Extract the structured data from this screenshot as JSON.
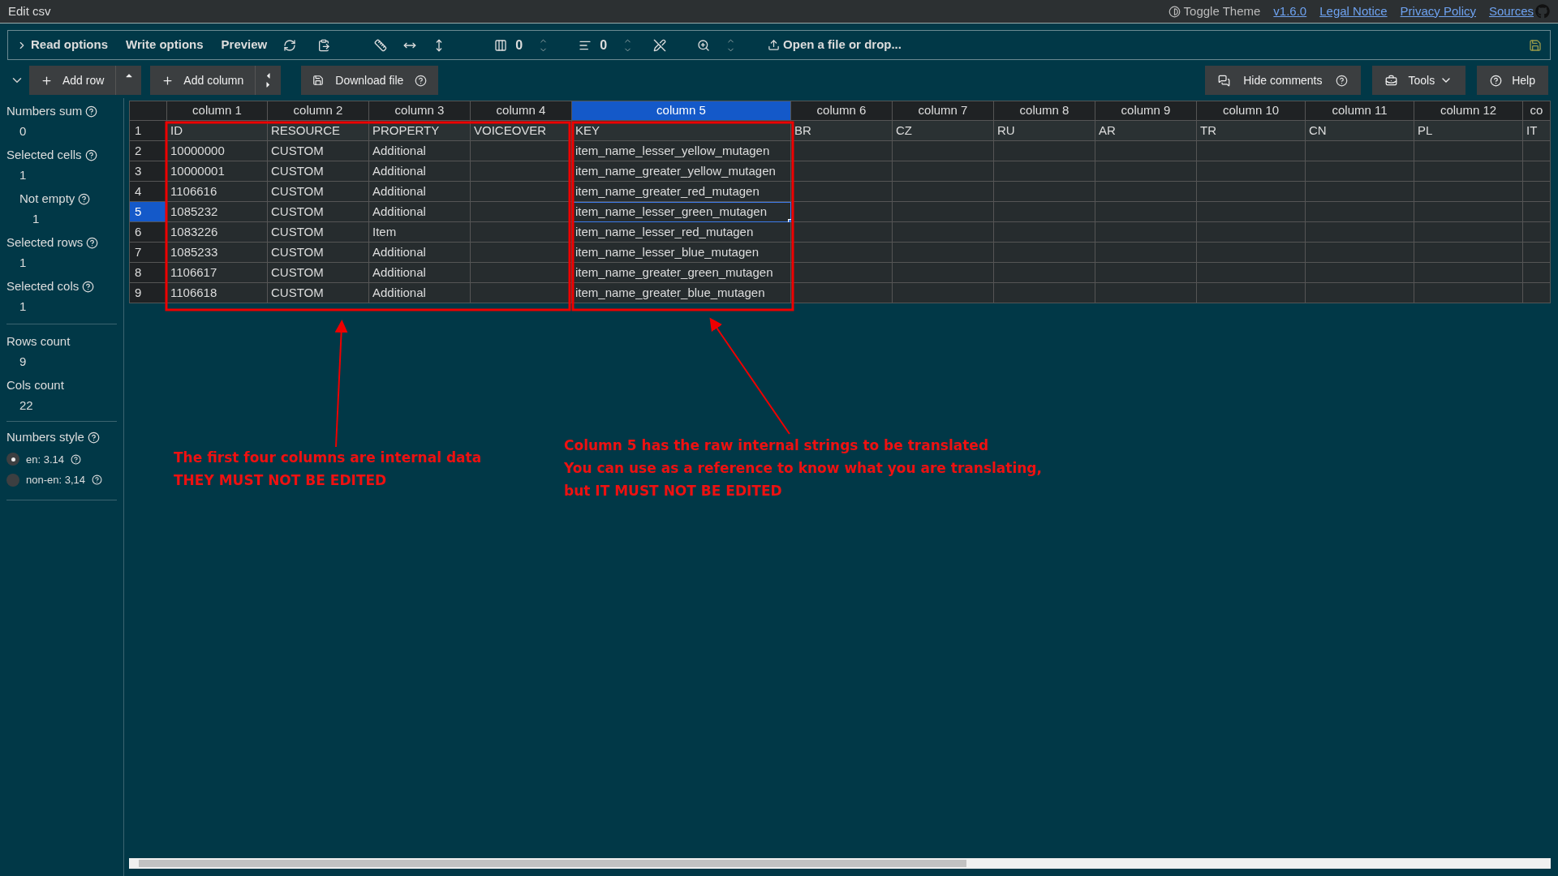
{
  "title_bar": {
    "title": "Edit csv",
    "theme_toggle": "Toggle Theme",
    "links": [
      "v1.6.0",
      "Legal Notice",
      "Privacy Policy",
      "Sources"
    ]
  },
  "toolbar": {
    "tabs": [
      "Read options",
      "Write options",
      "Preview"
    ],
    "column_counter": "0",
    "row_counter": "0",
    "open_file": "Open a file or drop..."
  },
  "actions": {
    "add_row": "Add row",
    "add_column": "Add column",
    "download": "Download file",
    "hide_comments": "Hide comments",
    "tools": "Tools",
    "help": "Help"
  },
  "sidebar": {
    "stats": [
      {
        "label": "Numbers sum",
        "value": "0",
        "nested": false
      },
      {
        "label": "Selected cells",
        "value": "1",
        "nested": false
      },
      {
        "label": "Not empty",
        "value": "1",
        "nested": true
      },
      {
        "label": "Selected rows",
        "value": "1",
        "nested": false
      },
      {
        "label": "Selected cols",
        "value": "1",
        "nested": false
      }
    ],
    "counts": [
      {
        "label": "Rows count",
        "value": "9"
      },
      {
        "label": "Cols count",
        "value": "22"
      }
    ],
    "numbers_style": {
      "label": "Numbers style",
      "options": [
        {
          "label": "en: 3.14",
          "selected": true
        },
        {
          "label": "non-en: 3,14",
          "selected": false
        }
      ]
    }
  },
  "grid": {
    "columns": [
      {
        "label": "column 1",
        "selected": false
      },
      {
        "label": "column 2",
        "selected": false
      },
      {
        "label": "column 3",
        "selected": false
      },
      {
        "label": "column 4",
        "selected": false
      },
      {
        "label": "column 5",
        "selected": true
      },
      {
        "label": "column 6",
        "selected": false
      },
      {
        "label": "column 7",
        "selected": false
      },
      {
        "label": "column 8",
        "selected": false
      },
      {
        "label": "column 9",
        "selected": false
      },
      {
        "label": "column 10",
        "selected": false
      },
      {
        "label": "column 11",
        "selected": false
      },
      {
        "label": "column 12",
        "selected": false
      },
      {
        "label": "co",
        "selected": false
      }
    ],
    "rows": [
      {
        "number": "1",
        "selected": false,
        "cells": [
          "ID",
          "RESOURCE",
          "PROPERTY",
          "VOICEOVER",
          "KEY",
          "BR",
          "CZ",
          "RU",
          "AR",
          "TR",
          "CN",
          "PL",
          "IT"
        ]
      },
      {
        "number": "2",
        "selected": false,
        "cells": [
          "10000000",
          "CUSTOM",
          "Additional",
          "",
          "item_name_lesser_yellow_mutagen",
          "",
          "",
          "",
          "",
          "",
          "",
          "",
          ""
        ]
      },
      {
        "number": "3",
        "selected": false,
        "cells": [
          "10000001",
          "CUSTOM",
          "Additional",
          "",
          "item_name_greater_yellow_mutagen",
          "",
          "",
          "",
          "",
          "",
          "",
          "",
          ""
        ]
      },
      {
        "number": "4",
        "selected": false,
        "cells": [
          "1106616",
          "CUSTOM",
          "Additional",
          "",
          "item_name_greater_red_mutagen",
          "",
          "",
          "",
          "",
          "",
          "",
          "",
          ""
        ]
      },
      {
        "number": "5",
        "selected": true,
        "cells": [
          "1085232",
          "CUSTOM",
          "Additional",
          "",
          "item_name_lesser_green_mutagen",
          "",
          "",
          "",
          "",
          "",
          "",
          "",
          ""
        ]
      },
      {
        "number": "6",
        "selected": false,
        "cells": [
          "1083226",
          "CUSTOM",
          "Item",
          "",
          "item_name_lesser_red_mutagen",
          "",
          "",
          "",
          "",
          "",
          "",
          "",
          ""
        ]
      },
      {
        "number": "7",
        "selected": false,
        "cells": [
          "1085233",
          "CUSTOM",
          "Additional",
          "",
          "item_name_lesser_blue_mutagen",
          "",
          "",
          "",
          "",
          "",
          "",
          "",
          ""
        ]
      },
      {
        "number": "8",
        "selected": false,
        "cells": [
          "1106617",
          "CUSTOM",
          "Additional",
          "",
          "item_name_greater_green_mutagen",
          "",
          "",
          "",
          "",
          "",
          "",
          "",
          ""
        ]
      },
      {
        "number": "9",
        "selected": false,
        "cells": [
          "1106618",
          "CUSTOM",
          "Additional",
          "",
          "item_name_greater_blue_mutagen",
          "",
          "",
          "",
          "",
          "",
          "",
          "",
          ""
        ]
      }
    ]
  },
  "annotations": [
    {
      "lines": [
        "The first four columns are internal data",
        "THEY MUST NOT BE EDITED"
      ]
    },
    {
      "lines": [
        "Column 5 has the raw internal strings to be translated",
        "You can use as a reference to know what you are translating,",
        "but IT MUST NOT BE EDITED"
      ]
    }
  ]
}
